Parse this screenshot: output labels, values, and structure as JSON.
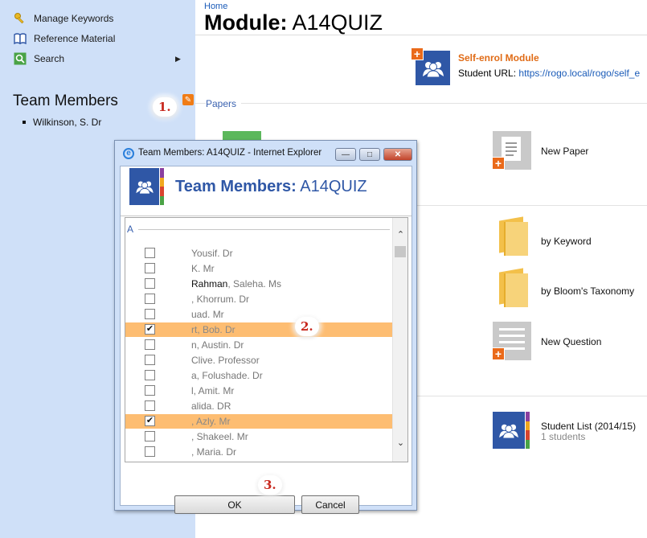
{
  "sidebar": {
    "items": [
      {
        "label": "Manage Keywords",
        "icon": "key-icon"
      },
      {
        "label": "Reference Material",
        "icon": "book-icon"
      },
      {
        "label": "Search",
        "icon": "search-icon"
      }
    ],
    "team_title": "Team Members",
    "team_member": "Wilkinson, S. Dr"
  },
  "main": {
    "breadcrumb": "Home",
    "title_label": "Module:",
    "title_value": "A14QUIZ",
    "self_enrol": {
      "title": "Self-enrol Module",
      "url_label": "Student URL:",
      "url": "https://rogo.local/rogo/self_e"
    },
    "papers_label": "Papers",
    "new_paper": "New Paper",
    "by_keyword": "by Keyword",
    "by_blooms": "by Bloom's Taxonomy",
    "new_question": "New Question",
    "student_list": {
      "label": "Student List (2014/15)",
      "count": "1 students"
    }
  },
  "dialog": {
    "window_title": "Team Members: A14QUIZ - Internet Explorer",
    "heading_label": "Team Members:",
    "heading_value": "A14QUIZ",
    "letter": "A",
    "rows": [
      {
        "bold": "",
        "rest": "Yousif. Dr",
        "checked": false,
        "selected": false
      },
      {
        "bold": "",
        "rest": "K. Mr",
        "checked": false,
        "selected": false
      },
      {
        "bold": "Rahman",
        "rest": ", Saleha. Ms",
        "checked": false,
        "selected": false
      },
      {
        "bold": "",
        "rest": ", Khorrum. Dr",
        "checked": false,
        "selected": false
      },
      {
        "bold": "",
        "rest": "uad. Mr",
        "checked": false,
        "selected": false
      },
      {
        "bold": "",
        "rest": "rt, Bob. Dr",
        "checked": true,
        "selected": true
      },
      {
        "bold": "",
        "rest": "n, Austin. Dr",
        "checked": false,
        "selected": false
      },
      {
        "bold": "",
        "rest": "Clive. Professor",
        "checked": false,
        "selected": false
      },
      {
        "bold": "",
        "rest": "a, Folushade. Dr",
        "checked": false,
        "selected": false
      },
      {
        "bold": "",
        "rest": "l, Amit. Mr",
        "checked": false,
        "selected": false
      },
      {
        "bold": "",
        "rest": "alida. DR",
        "checked": false,
        "selected": false
      },
      {
        "bold": "",
        "rest": ", Azly. Mr",
        "checked": true,
        "selected": true
      },
      {
        "bold": "",
        "rest": ", Shakeel. Mr",
        "checked": false,
        "selected": false
      },
      {
        "bold": "",
        "rest": ", Maria. Dr",
        "checked": false,
        "selected": false
      }
    ],
    "ok_label": "OK",
    "cancel_label": "Cancel"
  },
  "markers": {
    "one": "1.",
    "two": "2.",
    "three": "3."
  },
  "colors": {
    "accent_orange": "#f07c16",
    "brand_blue": "#2f57a6",
    "selection": "#fdbd72",
    "sidebar_bg": "#cfe0f8"
  }
}
